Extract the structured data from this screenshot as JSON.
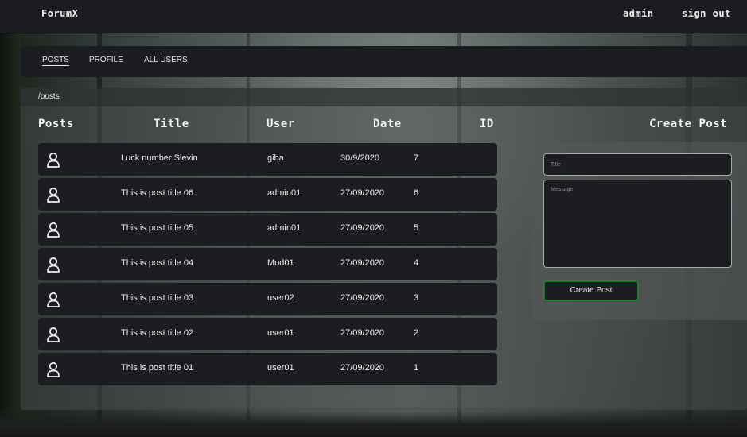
{
  "topbar": {
    "brand": "ForumX",
    "user": "admin",
    "signout": "sign out"
  },
  "nav": {
    "items": [
      "POSTS",
      "PROFILE",
      "ALL USERS"
    ]
  },
  "breadcrumb": "/posts",
  "headers": {
    "posts": "Posts",
    "title": "Title",
    "user": "User",
    "date": "Date",
    "id": "ID",
    "create": "Create Post"
  },
  "posts": [
    {
      "title": "Luck number Slevin",
      "user": "giba",
      "date": "30/9/2020",
      "id": "7"
    },
    {
      "title": "This is post title 06",
      "user": "admin01",
      "date": "27/09/2020",
      "id": "6"
    },
    {
      "title": "This is post title 05",
      "user": "admin01",
      "date": "27/09/2020",
      "id": "5"
    },
    {
      "title": "This is post title 04",
      "user": "Mod01",
      "date": "27/09/2020",
      "id": "4"
    },
    {
      "title": "This is post title 03",
      "user": "user02",
      "date": "27/09/2020",
      "id": "3"
    },
    {
      "title": "This is post title 02",
      "user": "user01",
      "date": "27/09/2020",
      "id": "2"
    },
    {
      "title": "This is post title 01",
      "user": "user01",
      "date": "27/09/2020",
      "id": "1"
    }
  ],
  "form": {
    "title_placeholder": "Title",
    "message_placeholder": "Message",
    "submit_label": "Create Post"
  },
  "colors": {
    "panel": "#1c1d20",
    "accent_border": "#1f7a2f"
  },
  "icons": {
    "post_row": "user-icon"
  }
}
